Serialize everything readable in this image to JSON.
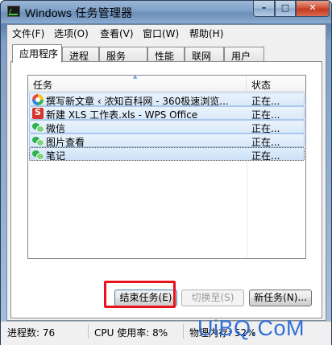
{
  "window": {
    "title": "Windows 任务管理器",
    "close_glyph": "✕",
    "max_glyph": "□",
    "min_glyph": "–"
  },
  "menu": [
    {
      "label": "文件(F)"
    },
    {
      "label": "选项(O)"
    },
    {
      "label": "查看(V)"
    },
    {
      "label": "窗口(W)"
    },
    {
      "label": "帮助(H)"
    }
  ],
  "tabs": [
    {
      "label": "应用程序",
      "active": true
    },
    {
      "label": "进程"
    },
    {
      "label": "服务"
    },
    {
      "label": "性能"
    },
    {
      "label": "联网"
    },
    {
      "label": "用户"
    }
  ],
  "list": {
    "columns": {
      "task": "任务",
      "status": "状态"
    },
    "rows": [
      {
        "name": "撰写新文章 ‹ 浓知百科网 - 360极速浏览...",
        "status": "正在...",
        "icon": "360-browser-icon"
      },
      {
        "name": "新建 XLS 工作表.xls - WPS Office",
        "status": "正在...",
        "icon": "wps-icon"
      },
      {
        "name": "微信",
        "status": "正在...",
        "icon": "wechat-icon"
      },
      {
        "name": "图片查看",
        "status": "正在...",
        "icon": "wechat-icon"
      },
      {
        "name": "笔记",
        "status": "正在...",
        "icon": "wechat-icon"
      }
    ]
  },
  "buttons": {
    "end_task": "结束任务(E)",
    "switch_to": "切换至(S)",
    "new_task": "新任务(N)..."
  },
  "statusbar": {
    "processes": "进程数: 76",
    "cpu": "CPU 使用率: 8%",
    "memory": "物理内存: 52%"
  },
  "watermark": "UiBQ.CoM",
  "colors": {
    "highlight": "#e8141b",
    "selection": "#d9e9f9",
    "watermark": "#2f6fd8"
  }
}
